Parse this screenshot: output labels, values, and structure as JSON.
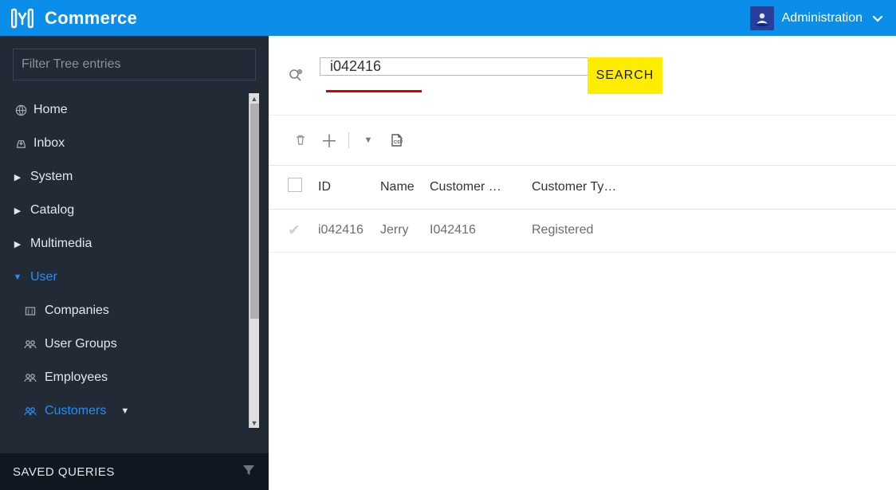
{
  "header": {
    "app_title": "Commerce",
    "admin_label": "Administration"
  },
  "sidebar": {
    "filter_placeholder": "Filter Tree entries",
    "items": [
      {
        "icon": "globe",
        "label": "Home"
      },
      {
        "icon": "download",
        "label": "Inbox"
      },
      {
        "caret": "right",
        "label": "System"
      },
      {
        "caret": "right",
        "label": "Catalog"
      },
      {
        "caret": "right",
        "label": "Multimedia"
      },
      {
        "caret": "down",
        "label": "User",
        "expanded": true
      }
    ],
    "user_children": [
      {
        "icon": "company",
        "label": "Companies"
      },
      {
        "icon": "group",
        "label": "User Groups"
      },
      {
        "icon": "group",
        "label": "Employees"
      },
      {
        "icon": "group",
        "label": "Customers",
        "active": true,
        "has_caret": true
      }
    ],
    "saved_queries_label": "SAVED QUERIES"
  },
  "search": {
    "value": "i042416",
    "button_label": "SEARCH"
  },
  "table": {
    "columns": [
      "ID",
      "Name",
      "Customer …",
      "Customer Ty…"
    ],
    "rows": [
      {
        "id": "i042416",
        "name": "Jerry",
        "customer": "I042416",
        "type": "Registered"
      }
    ]
  }
}
